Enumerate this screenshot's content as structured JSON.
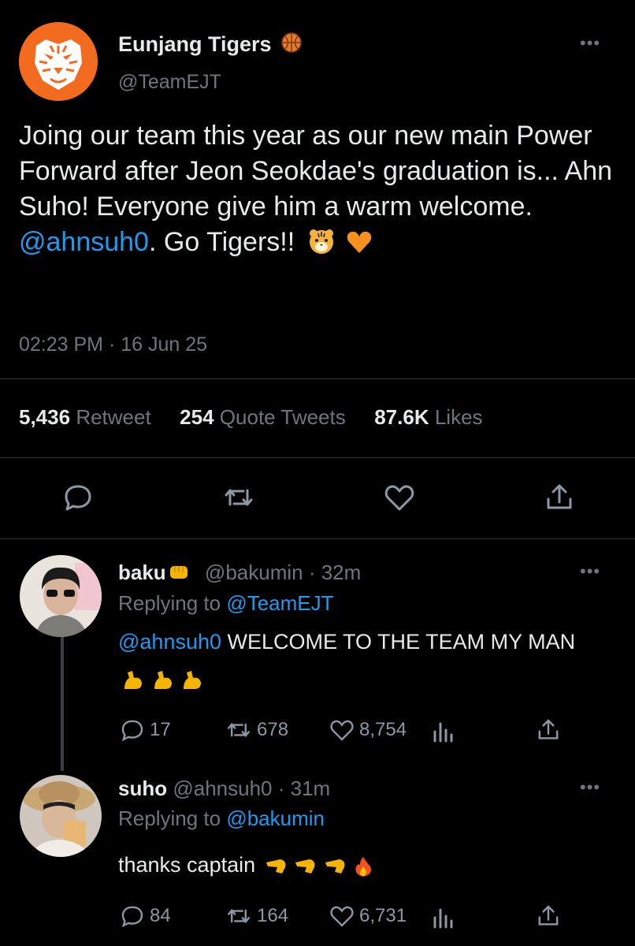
{
  "main_tweet": {
    "name": "Eunjang Tigers",
    "handle": "@TeamEJT",
    "text_before_mention": "Joing our team this year as our new main Power Forward after Jeon Seokdae's graduation is... Ahn Suho! Everyone give him a warm welcome. ",
    "mention": "@ahnsuh0",
    "text_after_mention": ". Go Tigers!!",
    "time": "02:23 PM · 16 Jun 25",
    "stats": {
      "retweets": "5,436",
      "retweets_label": "Retweet",
      "quotes": "254",
      "quotes_label": "Quote Tweets",
      "likes": "87.6K",
      "likes_label": "Likes"
    },
    "icons": [
      "basketball-icon",
      "tiger-face-emoji",
      "orange-heart-emoji",
      "reply-icon",
      "retweet-icon",
      "like-icon",
      "share-icon",
      "more-icon"
    ]
  },
  "replies": [
    {
      "name": "baku",
      "handle": "@bakumin",
      "time": "· 32m",
      "replying_label": "Replying to",
      "replying_to": "@TeamEJT",
      "mention": "@ahnsuh0",
      "text": " WELCOME TO THE TEAM MY MAN",
      "counts": {
        "replies": "17",
        "retweets": "678",
        "likes": "8,754"
      }
    },
    {
      "name": "suho",
      "handle": "@ahnsuh0",
      "time": "· 31m",
      "replying_label": "Replying to",
      "replying_to": "@bakumin",
      "text": "thanks captain",
      "counts": {
        "replies": "84",
        "retweets": "164",
        "likes": "6,731"
      }
    }
  ],
  "colors": {
    "background": "#000000",
    "text": "#e7e9ea",
    "muted": "#6e767d",
    "link": "#1d9bf0",
    "brand": "#f26b1f"
  }
}
